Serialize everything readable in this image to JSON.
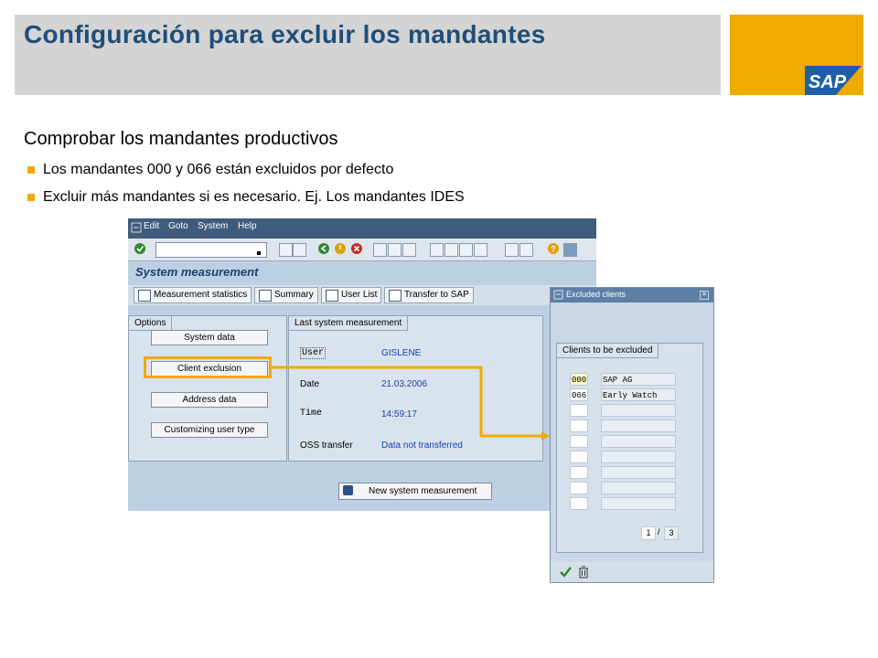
{
  "slide": {
    "title": "Configuración para excluir los mandantes",
    "subtitle": "Comprobar los mandantes productivos",
    "bullets": [
      "Los mandantes 000 y 066 están excluidos por defecto",
      "Excluir más mandantes si es necesario. Ej. Los mandantes IDES"
    ],
    "logo_text": "SAP",
    "accent_color": "#f0ab00",
    "title_color": "#1f4e79"
  },
  "sap_window": {
    "menu": [
      "Edit",
      "Goto",
      "System",
      "Help"
    ],
    "screen_title": "System measurement",
    "toolbar_buttons": [
      "Measurement statistics",
      "Summary",
      "User List",
      "Transfer to SAP"
    ],
    "options_title": "Options",
    "options_buttons": [
      "System data",
      "Client exclusion",
      "Address data",
      "Customizing user type"
    ],
    "last_title": "Last system measurement",
    "fields": [
      {
        "label": "User",
        "value": "GISLENE"
      },
      {
        "label": "Date",
        "value": "21.03.2006"
      },
      {
        "label": "Time",
        "value": "14:59:17"
      },
      {
        "label": "OSS transfer",
        "value": "Data not transferred"
      }
    ],
    "new_button": "New system measurement"
  },
  "dialog": {
    "title": "Excluded clients",
    "group_title": "Clients to be excluded",
    "rows": [
      {
        "client": "000",
        "name": "SAP AG"
      },
      {
        "client": "066",
        "name": "Early Watch"
      },
      {
        "client": "",
        "name": ""
      },
      {
        "client": "",
        "name": ""
      },
      {
        "client": "",
        "name": ""
      },
      {
        "client": "",
        "name": ""
      },
      {
        "client": "",
        "name": ""
      },
      {
        "client": "",
        "name": ""
      },
      {
        "client": "",
        "name": ""
      }
    ],
    "page_current": "1",
    "page_separator": "/",
    "page_total": "3"
  }
}
